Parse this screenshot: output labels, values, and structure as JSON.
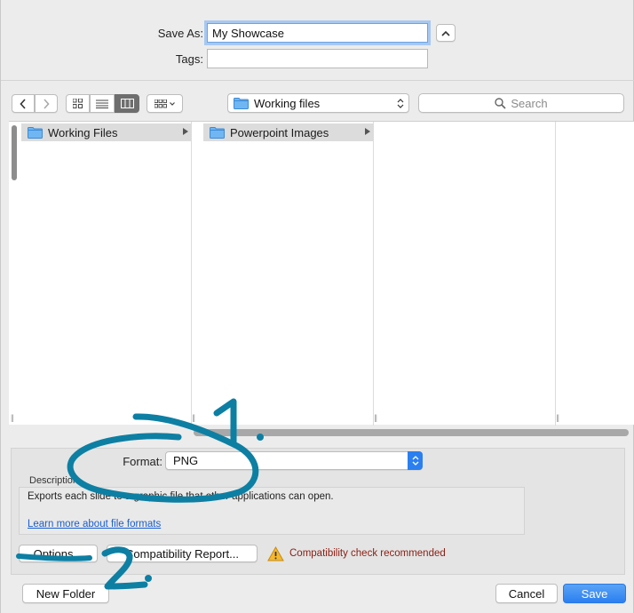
{
  "save_as": {
    "label": "Save As:",
    "value": "My Showcase"
  },
  "tags": {
    "label": "Tags:",
    "value": ""
  },
  "toolbar": {
    "location": "Working files",
    "search_placeholder": "Search"
  },
  "columns": [
    {
      "item": "Working Files"
    },
    {
      "item": "Powerpoint Images"
    }
  ],
  "format": {
    "label": "Format:",
    "value": "PNG",
    "description_label": "Description",
    "description_text": "Exports each slide to a graphic file that other applications can open.",
    "learn_more": "Learn more about file formats"
  },
  "buttons": {
    "options": "Options...",
    "compatibility": "Compatibility Report...",
    "compat_warning": "Compatibility check recommended",
    "new_folder": "New Folder",
    "cancel": "Cancel",
    "save": "Save"
  },
  "annotations": {
    "one": "1.",
    "two": "2."
  },
  "colors": {
    "accent": "#2b7ff0",
    "warning_text": "#8a1d12",
    "annotation": "#0d7fa3"
  }
}
